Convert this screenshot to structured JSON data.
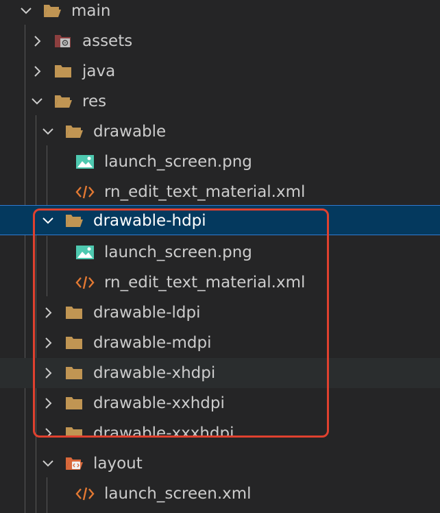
{
  "tree": {
    "rows": [
      {
        "label": "main",
        "icon": "folder-open-icon",
        "state": "expanded"
      },
      {
        "label": "assets",
        "icon": "folder-assets-icon",
        "state": "collapsed"
      },
      {
        "label": "java",
        "icon": "folder-icon",
        "state": "collapsed"
      },
      {
        "label": "res",
        "icon": "folder-open-icon",
        "state": "expanded"
      },
      {
        "label": "drawable",
        "icon": "folder-open-icon",
        "state": "expanded"
      },
      {
        "label": "launch_screen.png",
        "icon": "image-file-icon"
      },
      {
        "label": "rn_edit_text_material.xml",
        "icon": "xml-file-icon"
      },
      {
        "label": "drawable-hdpi",
        "icon": "folder-open-icon",
        "state": "expanded",
        "selected": true
      },
      {
        "label": "launch_screen.png",
        "icon": "image-file-icon"
      },
      {
        "label": "rn_edit_text_material.xml",
        "icon": "xml-file-icon"
      },
      {
        "label": "drawable-ldpi",
        "icon": "folder-icon",
        "state": "collapsed"
      },
      {
        "label": "drawable-mdpi",
        "icon": "folder-icon",
        "state": "collapsed"
      },
      {
        "label": "drawable-xhdpi",
        "icon": "folder-icon",
        "state": "collapsed",
        "hover": true
      },
      {
        "label": "drawable-xxhdpi",
        "icon": "folder-icon",
        "state": "collapsed"
      },
      {
        "label": "drawable-xxxhdpi",
        "icon": "folder-icon",
        "state": "collapsed"
      },
      {
        "label": "layout",
        "icon": "folder-layout-icon",
        "state": "expanded"
      },
      {
        "label": "launch_screen.xml",
        "icon": "xml-file-icon"
      }
    ]
  },
  "colors": {
    "folder": "#c09553",
    "image": "#4ec9b0",
    "xml": "#e37933",
    "highlight": "#e0412f",
    "selection": "#04395e"
  }
}
